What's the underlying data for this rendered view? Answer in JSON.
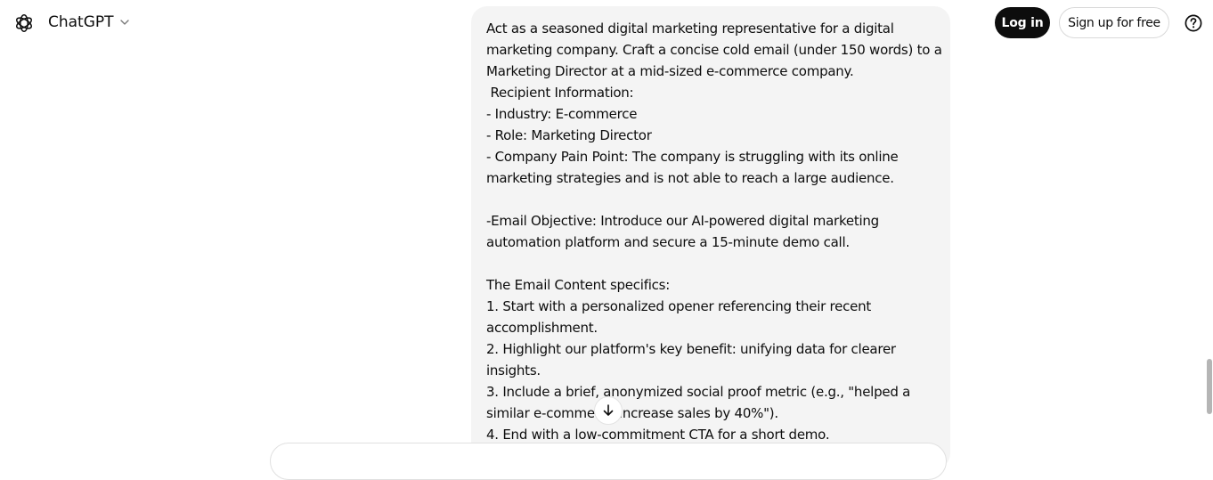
{
  "header": {
    "app_name": "ChatGPT",
    "login_label": "Log in",
    "signup_label": "Sign up for free"
  },
  "icons": {
    "logo": "openai-logo-icon",
    "model_menu": "chevron-down-icon",
    "help": "help-icon",
    "scroll": "arrow-down-icon"
  },
  "message": {
    "lines": [
      "Act as a seasoned digital marketing representative for a digital",
      "marketing company. Craft a concise cold email (under 150 words) to a",
      "Marketing Director at a mid-sized e-commerce company.",
      " Recipient Information:",
      "- Industry: E-commerce",
      "- Role: Marketing Director",
      "- Company Pain Point: The company is struggling with its online",
      "marketing strategies and is not able to reach a large audience.",
      "",
      "-Email Objective: Introduce our AI-powered digital marketing",
      "automation platform and secure a 15-minute demo call.",
      "",
      "The Email Content specifics:",
      "1. Start with a personalized opener referencing their recent",
      "accomplishment.",
      "2. Highlight our platform's key benefit: unifying data for clearer",
      "insights.",
      "3. Include a brief, anonymized social proof metric (e.g., \"helped a",
      "similar e-commerce increase sales by 40%\").",
      "4. End with a low-commitment CTA for a short demo."
    ]
  },
  "colors": {
    "bubble_bg": "#f4f4f4",
    "primary_button": "#0d0d0d"
  }
}
